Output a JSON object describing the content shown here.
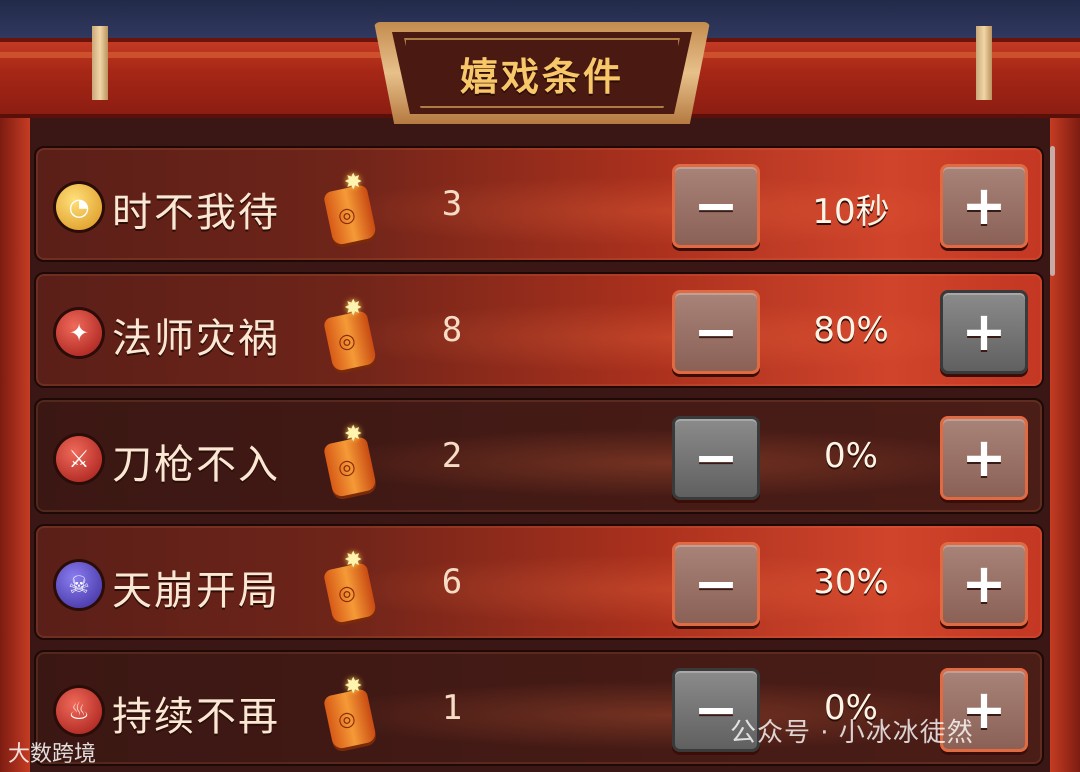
{
  "title": "嬉戏条件",
  "rows": [
    {
      "name": "时不我待",
      "icon": "clock-icon",
      "icon_glyph": "◔",
      "icon_color": "gold",
      "score": "3",
      "value": "10秒",
      "active": true,
      "minus_enabled": true,
      "plus_enabled": true
    },
    {
      "name": "法师灾祸",
      "icon": "magic-shield-icon",
      "icon_glyph": "✦",
      "icon_color": "red",
      "score": "8",
      "value": "80%",
      "active": true,
      "minus_enabled": true,
      "plus_enabled": false
    },
    {
      "name": "刀枪不入",
      "icon": "sword-shield-icon",
      "icon_glyph": "⚔",
      "icon_color": "red",
      "score": "2",
      "value": "0%",
      "active": false,
      "minus_enabled": false,
      "plus_enabled": true
    },
    {
      "name": "天崩开局",
      "icon": "skull-icon",
      "icon_glyph": "☠",
      "icon_color": "purple",
      "score": "6",
      "value": "30%",
      "active": true,
      "minus_enabled": true,
      "plus_enabled": true
    },
    {
      "name": "持续不再",
      "icon": "flame-shield-icon",
      "icon_glyph": "♨",
      "icon_color": "red",
      "score": "1",
      "value": "0%",
      "active": false,
      "minus_enabled": false,
      "plus_enabled": true
    }
  ],
  "buttons": {
    "minus": "−",
    "plus": "+"
  },
  "watermark": {
    "left": "大数跨境",
    "right": "公众号 · 小冰冰徒然"
  }
}
